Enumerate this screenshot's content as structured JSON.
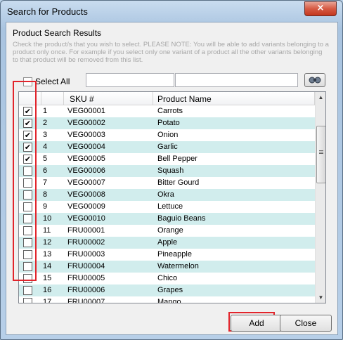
{
  "window": {
    "title": "Search for Products",
    "close_glyph": "×"
  },
  "heading": "Product Search Results",
  "note": "Check the product/s that you wish to select. PLEASE NOTE: You will be able to add variants belonging to a product only once. For example if you select only one variant of a product all the other variants belonging to that product will be removed from this list.",
  "select_all_label": "Select All",
  "search": {
    "field1": "",
    "field2": "",
    "button_icon": "search-binoculars-icon"
  },
  "grid": {
    "columns": [
      "",
      "",
      "SKU #",
      "Product Name"
    ],
    "rows": [
      {
        "checked": true,
        "num": "1",
        "sku": "VEG00001",
        "name": "Carrots"
      },
      {
        "checked": true,
        "num": "2",
        "sku": "VEG00002",
        "name": "Potato"
      },
      {
        "checked": true,
        "num": "3",
        "sku": "VEG00003",
        "name": "Onion"
      },
      {
        "checked": true,
        "num": "4",
        "sku": "VEG00004",
        "name": "Garlic"
      },
      {
        "checked": true,
        "num": "5",
        "sku": "VEG00005",
        "name": "Bell Pepper"
      },
      {
        "checked": false,
        "num": "6",
        "sku": "VEG00006",
        "name": "Squash"
      },
      {
        "checked": false,
        "num": "7",
        "sku": "VEG00007",
        "name": "Bitter Gourd"
      },
      {
        "checked": false,
        "num": "8",
        "sku": "VEG00008",
        "name": "Okra"
      },
      {
        "checked": false,
        "num": "9",
        "sku": "VEG00009",
        "name": "Lettuce"
      },
      {
        "checked": false,
        "num": "10",
        "sku": "VEG00010",
        "name": "Baguio Beans"
      },
      {
        "checked": false,
        "num": "11",
        "sku": "FRU00001",
        "name": "Orange"
      },
      {
        "checked": false,
        "num": "12",
        "sku": "FRU00002",
        "name": "Apple"
      },
      {
        "checked": false,
        "num": "13",
        "sku": "FRU00003",
        "name": "Pineapple"
      },
      {
        "checked": false,
        "num": "14",
        "sku": "FRU00004",
        "name": "Watermelon"
      },
      {
        "checked": false,
        "num": "15",
        "sku": "FRU00005",
        "name": "Chico"
      },
      {
        "checked": false,
        "num": "16",
        "sku": "FRU00006",
        "name": "Grapes"
      },
      {
        "checked": false,
        "num": "17",
        "sku": "FRU00007",
        "name": "Mango"
      }
    ]
  },
  "buttons": {
    "add": "Add",
    "close": "Close"
  },
  "colors": {
    "highlight": "#e2252c",
    "alt_row": "#d1eded"
  }
}
